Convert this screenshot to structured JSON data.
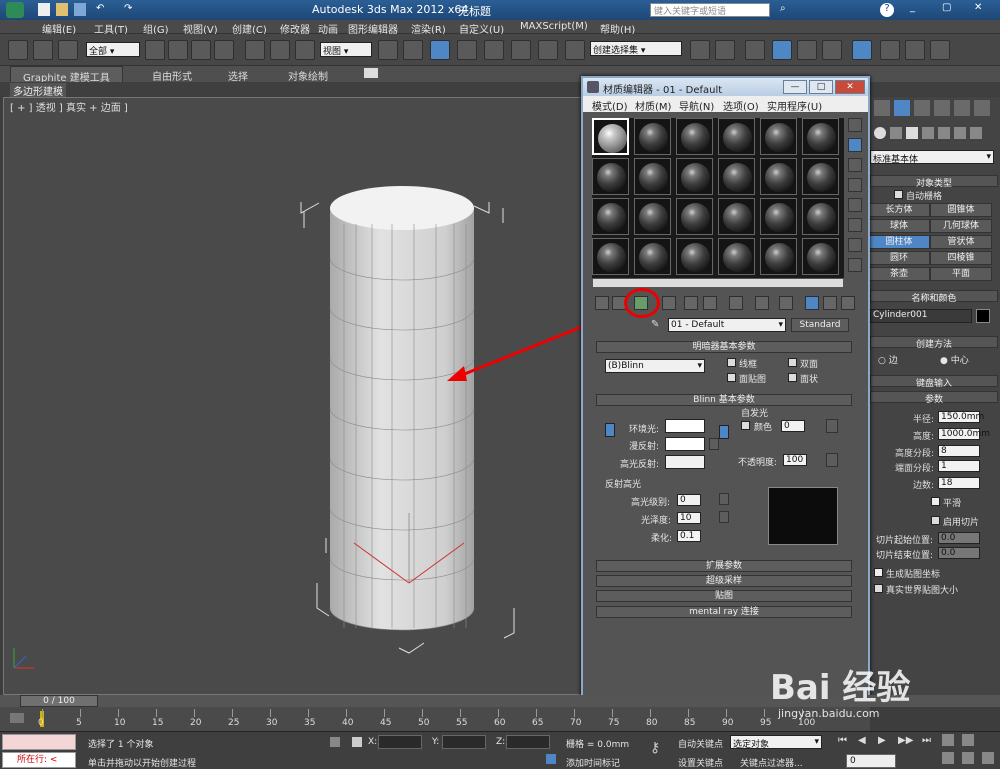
{
  "app": {
    "title": "Autodesk 3ds Max  2012 x64",
    "doc": "无标题",
    "search_placeholder": "键入关键字或短语"
  },
  "menu": [
    "编辑(E)",
    "工具(T)",
    "组(G)",
    "视图(V)",
    "创建(C)",
    "修改器",
    "动画",
    "图形编辑器",
    "渲染(R)",
    "自定义(U)",
    "MAXScript(M)",
    "帮助(H)"
  ],
  "toolbar": {
    "filter": "全部",
    "refcoord": "视图",
    "selset": "创建选择集"
  },
  "ribbon": {
    "tabs": [
      "Graphite 建模工具",
      "自由形式",
      "选择",
      "对象绘制"
    ],
    "sub": "多边形建模"
  },
  "viewport": {
    "label": "[ + ] 透视 ] 真实 + 边面 ]"
  },
  "cmd": {
    "category": "标准基本体",
    "objtype_title": "对象类型",
    "autogrid": "自动栅格",
    "objects": [
      "长方体",
      "圆锥体",
      "球体",
      "几何球体",
      "圆柱体",
      "管状体",
      "圆环",
      "四棱锥",
      "茶壶",
      "平面"
    ],
    "namecolor_title": "名称和颜色",
    "name": "Cylinder001",
    "method_title": "创建方法",
    "edge": "边",
    "center": "中心",
    "kbd_title": "键盘输入",
    "params_title": "参数",
    "params": [
      {
        "label": "半径:",
        "value": "150.0mm"
      },
      {
        "label": "高度:",
        "value": "1000.0mm"
      },
      {
        "label": "高度分段:",
        "value": "8"
      },
      {
        "label": "端面分段:",
        "value": "1"
      },
      {
        "label": "边数:",
        "value": "18"
      }
    ],
    "smooth": "平滑",
    "slice": "启用切片",
    "slice_from": "切片起始位置:",
    "slice_to": "切片结束位置:",
    "slice_val": "0.0",
    "genmap": "生成贴图坐标",
    "realworld": "真实世界贴图大小"
  },
  "medit": {
    "title": "材质编辑器 - 01 - Default",
    "menu": [
      "模式(D)",
      "材质(M)",
      "导航(N)",
      "选项(O)",
      "实用程序(U)"
    ],
    "material_name": "01 - Default",
    "material_type": "Standard",
    "shader_title": "明暗器基本参数",
    "shader": "(B)Blinn",
    "wire": "线框",
    "twosided": "双面",
    "facemap": "面贴图",
    "faceted": "面状",
    "blinn_title": "Blinn 基本参数",
    "selfillum": "自发光",
    "color": "颜色",
    "selfval": "0",
    "ambient": "环境光:",
    "diffuse": "漫反射:",
    "specular": "高光反射:",
    "opacity": "不透明度:",
    "opacity_val": "100",
    "spec_title": "反射高光",
    "spec_level": "高光级别:",
    "spec_level_val": "0",
    "gloss": "光泽度:",
    "gloss_val": "10",
    "soften": "柔化:",
    "soften_val": "0.1",
    "rollouts": [
      "扩展参数",
      "超级采样",
      "贴图",
      "mental ray 连接"
    ]
  },
  "time": {
    "frame": "0 / 100",
    "ticks": [
      "0",
      "5",
      "10",
      "15",
      "20",
      "25",
      "30",
      "35",
      "40",
      "45",
      "50",
      "55",
      "60",
      "65",
      "70",
      "75",
      "80",
      "85",
      "90",
      "95",
      "100"
    ]
  },
  "status": {
    "selected": "选择了 1 个对象",
    "prompt": "单击并拖动以开始创建过程",
    "running": "所在行:",
    "x": "X:",
    "y": "Y:",
    "z": "Z:",
    "grid": "栅格 = 0.0mm",
    "autokey": "自动关键点",
    "setkey": "设置关键点",
    "keymode": "选定对象",
    "addtag": "添加时间标记",
    "keyfilter": "关键点过滤器...",
    "frame": "0"
  },
  "watermark": "Bai 经验",
  "watermark_url": "jingyan.baidu.com"
}
